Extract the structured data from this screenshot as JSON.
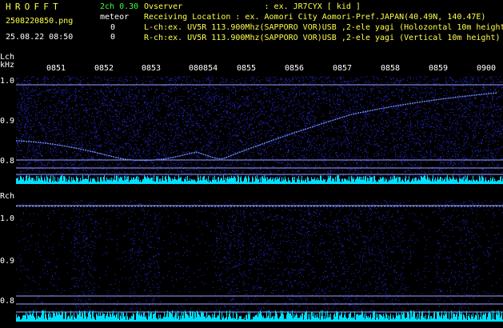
{
  "header": {
    "app_title": "HROFFT",
    "channels_version": "2ch 0.30",
    "file_name": "2508220850.png",
    "meteor_label": "meteor",
    "meteor_count_l": "0",
    "meteor_count_r": "0",
    "datetime": "25.08.22 08:50"
  },
  "info": {
    "observer": "Ovserver                 : ex. JR7CYX [ kid ]",
    "location": "Receiving Location : ex. Aomori City Aomori-Pref.JAPAN(40.49N, 140.47E)",
    "lch": "L-ch:ex. UV5R 113.900Mhz(SAPPORO VOR)USB ,2-ele yagi (Holozontal 10m height",
    "rch": "R-ch:ex. UV5R 113.900Mhz(SAPPORO VOR)USB ,2-ele yagi (Vertical 10m height)"
  },
  "time_ticks": [
    "0851",
    "0852",
    "0853",
    "080854",
    "0855",
    "0856",
    "0857",
    "0858",
    "0859",
    "0900"
  ],
  "lch_panel": {
    "label": "Lch",
    "unit": "kHz",
    "y_labels": [
      "1.0",
      "0.9",
      "0.8"
    ]
  },
  "rch_panel": {
    "label": "Rch",
    "y_labels": [
      "1.0",
      "0.9",
      "0.8"
    ]
  },
  "colors": {
    "background": "#000000",
    "title": "#ffff4a",
    "version": "#3cff3c",
    "noise": "#2a2ad6",
    "trace": "#6c8cff",
    "level": "#00e0ff"
  }
}
